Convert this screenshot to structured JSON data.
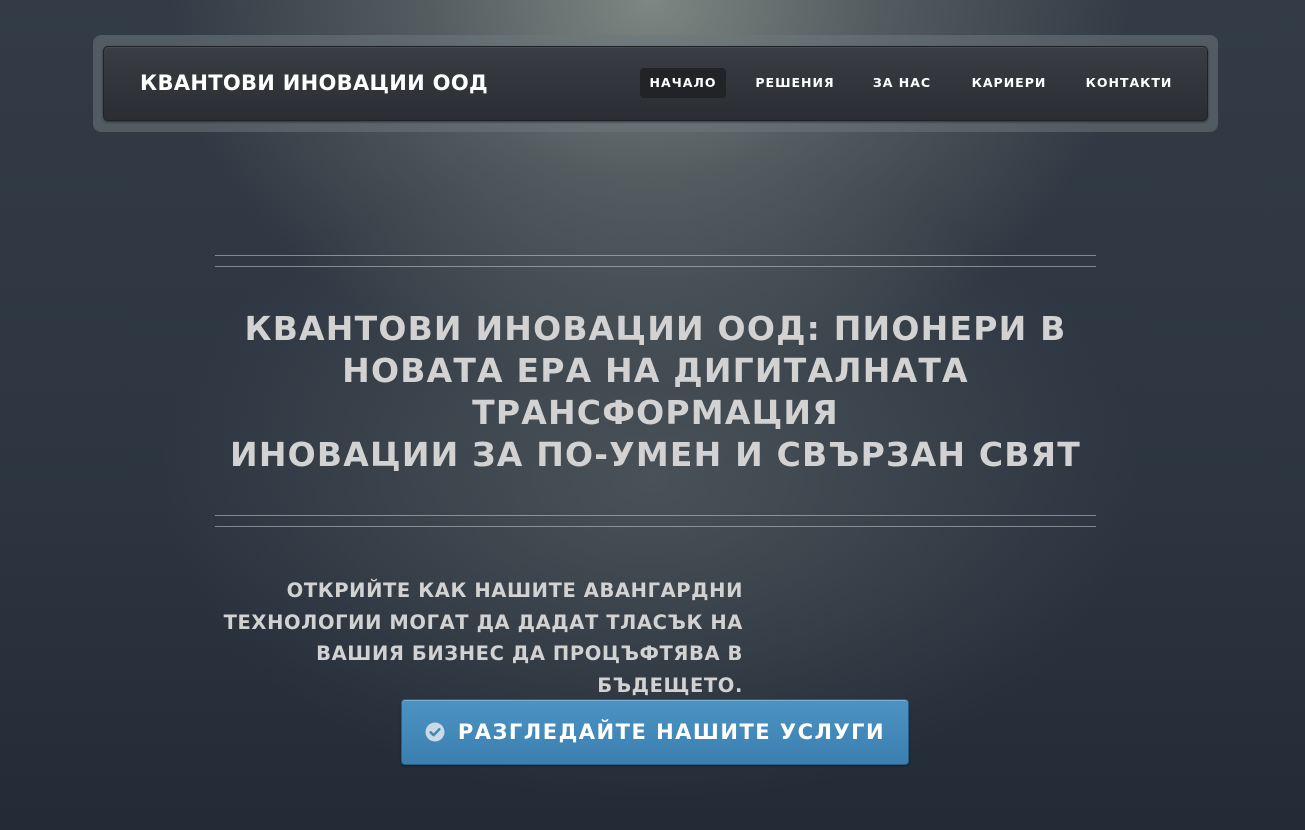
{
  "header": {
    "brand": "КВАНТОВИ ИНОВАЦИИ ООД",
    "nav": [
      {
        "label": "НАЧАЛО",
        "active": true
      },
      {
        "label": "РЕШЕНИЯ",
        "active": false
      },
      {
        "label": "ЗА НАС",
        "active": false
      },
      {
        "label": "КАРИЕРИ",
        "active": false
      },
      {
        "label": "КОНТАКТИ",
        "active": false
      }
    ]
  },
  "hero": {
    "title_lines": [
      "КВАНТОВИ ИНОВАЦИИ ООД: ПИОНЕРИ В",
      "НОВАТА ЕРА НА ДИГИТАЛНАТА",
      "ТРАНСФОРМАЦИЯ",
      "ИНОВАЦИИ ЗА ПО-УМЕН И СВЪРЗАН СВЯТ"
    ],
    "lead_lines": [
      "ОТКРИЙТЕ КАК НАШИТЕ АВАНГАРДНИ",
      "ТЕХНОЛОГИИ МОГАТ ДА ДАДАТ ТЛАСЪК НА",
      "ВАШИЯ БИЗНЕС ДА ПРОЦЪФТЯВА В",
      "БЪДЕЩЕТО."
    ],
    "cta": {
      "label": "РАЗГЛЕДАЙТЕ НАШИТЕ УСЛУГИ",
      "icon": "check-circle-icon"
    }
  },
  "colors": {
    "accent": "#3f86b8",
    "nav_bar": "#2f3237",
    "text": "#d2d2d2"
  }
}
